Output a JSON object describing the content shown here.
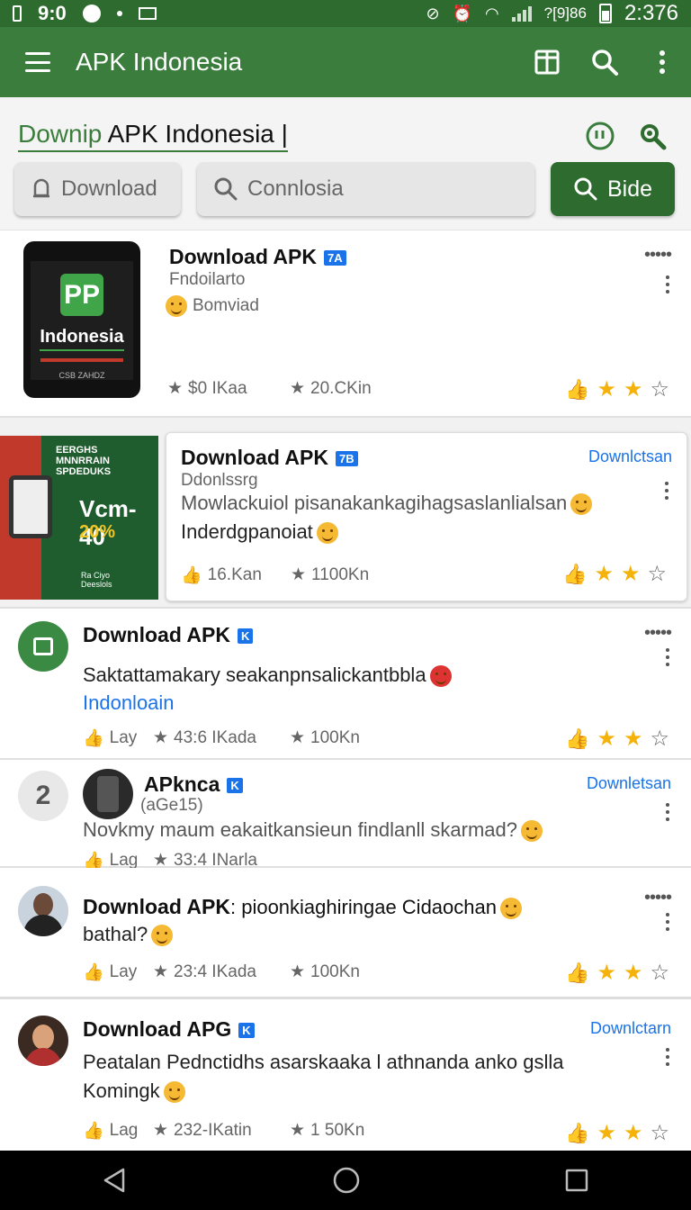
{
  "status_bar": {
    "time_left": "9:0",
    "icons_left": [
      "sim-icon",
      "data-icon",
      "dot-icon",
      "mail-icon"
    ],
    "signal_text": "?[9]86",
    "time_right": "2:376"
  },
  "app_bar": {
    "title": "APK Indonesia"
  },
  "search": {
    "query_green": "Downip",
    "query_rest": " APK Indonesia |",
    "chips": [
      {
        "label": "Download"
      },
      {
        "label": "Connlosia"
      },
      {
        "label": "Bide"
      }
    ]
  },
  "feed": [
    {
      "title": "Download APK",
      "badge": "7A",
      "subtitle": "Fndoilarto",
      "tagline": "Bomviad",
      "thumb_logo": "PP",
      "thumb_label": "Indonesia",
      "thumb_small": "CSB ZAHDZ",
      "stats": [
        "$0 IKaa",
        "20.CKin"
      ]
    },
    {
      "title": "Download APK",
      "badge": "7B",
      "subtitle": "Ddonlssrg",
      "link": "Downlctsan",
      "body_line1": "Mowlackuiol pisanakankagihagsaslanlialsan",
      "body_line2": "Inderdgpanoiat",
      "promo_top": "EERGHS\nMNNRRAIN\nSPDEDUKS",
      "promo_big": "Vcm-40",
      "promo_pct": "20%",
      "promo_small": "Ra Ciyo\nDeeslols",
      "stats": [
        "16.Kan",
        "1100Kn"
      ]
    },
    {
      "title": "Download APK",
      "badge": "K",
      "body_line1": "Saktattamakary seakanpnsalickantbbla",
      "link_line": "Indonloain",
      "stats": [
        "Lay",
        "43:6 IKada",
        "100Kn"
      ]
    },
    {
      "avatar_num": "2",
      "title": "APkncа",
      "badge": "K",
      "subtitle": "(aGe15)",
      "link": "Downletsan",
      "body_line1": "Novkmy maum eakaitkansieun findlanll skarmad?",
      "stats": [
        "Lag",
        "33:4 INarla"
      ]
    },
    {
      "title": "Download APK",
      "title_rest": ": pioonkiaghiringae Cidaochan",
      "body_line2": "bathal?",
      "stats": [
        "Lay",
        "23:4 IKada",
        "100Kn"
      ]
    },
    {
      "title": "Download APG",
      "badge": "K",
      "link": "Downlctarn",
      "body_line1": "Peatalan Pednctidhs asarskaaka l athnanda anko gslla",
      "body_line2": "Komingk",
      "stats": [
        "Lag",
        "232-IKatin",
        "1 50Kn"
      ]
    }
  ],
  "colors": {
    "app_bar": "#3b7d3c",
    "status_bar": "#2e6b2f",
    "accent_blue": "#1a73e8",
    "star": "#f5b20a"
  }
}
